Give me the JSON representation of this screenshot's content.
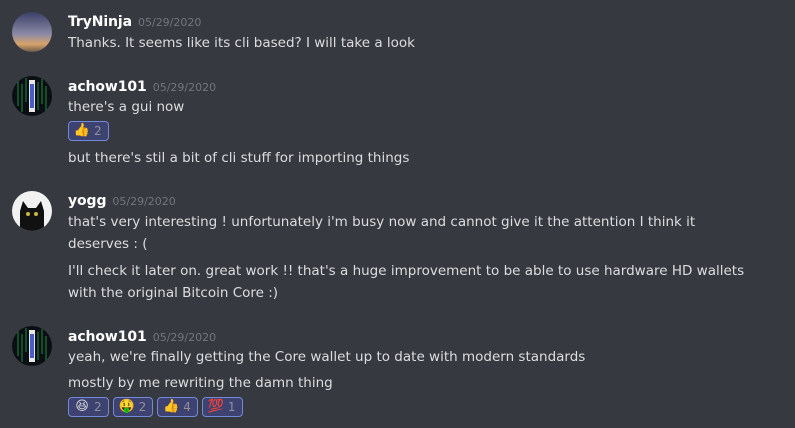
{
  "messages": [
    {
      "username": "TryNinja",
      "timestamp": "05/29/2020",
      "lines": [
        "Thanks. It seems like its cli based? I will take a look"
      ]
    },
    {
      "username": "achow101",
      "timestamp": "05/29/2020",
      "lines": [
        "there's a gui now",
        "but there's stil a bit of cli stuff for importing things"
      ],
      "reactions": [
        {
          "emoji": "👍",
          "count": "2",
          "icon": "thumbs-up-icon"
        }
      ]
    },
    {
      "username": "yogg",
      "timestamp": "05/29/2020",
      "lines": [
        "that's very interesting ! unfortunately i'm busy now and cannot give it the attention I think it deserves : (",
        "I'll check it later on. great work !! that's a huge improvement to be able to use hardware HD wallets with the original Bitcoin Core :)"
      ]
    },
    {
      "username": "achow101",
      "timestamp": "05/29/2020",
      "lines": [
        "yeah, we're finally getting the Core wallet up to date with modern standards",
        "mostly by me rewriting the damn thing"
      ],
      "reactions": [
        {
          "emoji": "😆",
          "count": "2",
          "icon": "laughing-face-icon"
        },
        {
          "emoji": "🤑",
          "count": "2",
          "icon": "money-mouth-face-icon"
        },
        {
          "emoji": "👍",
          "count": "4",
          "icon": "thumbs-up-icon"
        },
        {
          "emoji": "💯",
          "count": "1",
          "icon": "hundred-points-icon"
        }
      ]
    }
  ],
  "colors": {
    "background": "#36393f",
    "username": "#ffffff",
    "timestamp": "#72767d",
    "text": "#dcddde",
    "reaction_bg": "#3e4271",
    "reaction_border": "#7289da"
  }
}
